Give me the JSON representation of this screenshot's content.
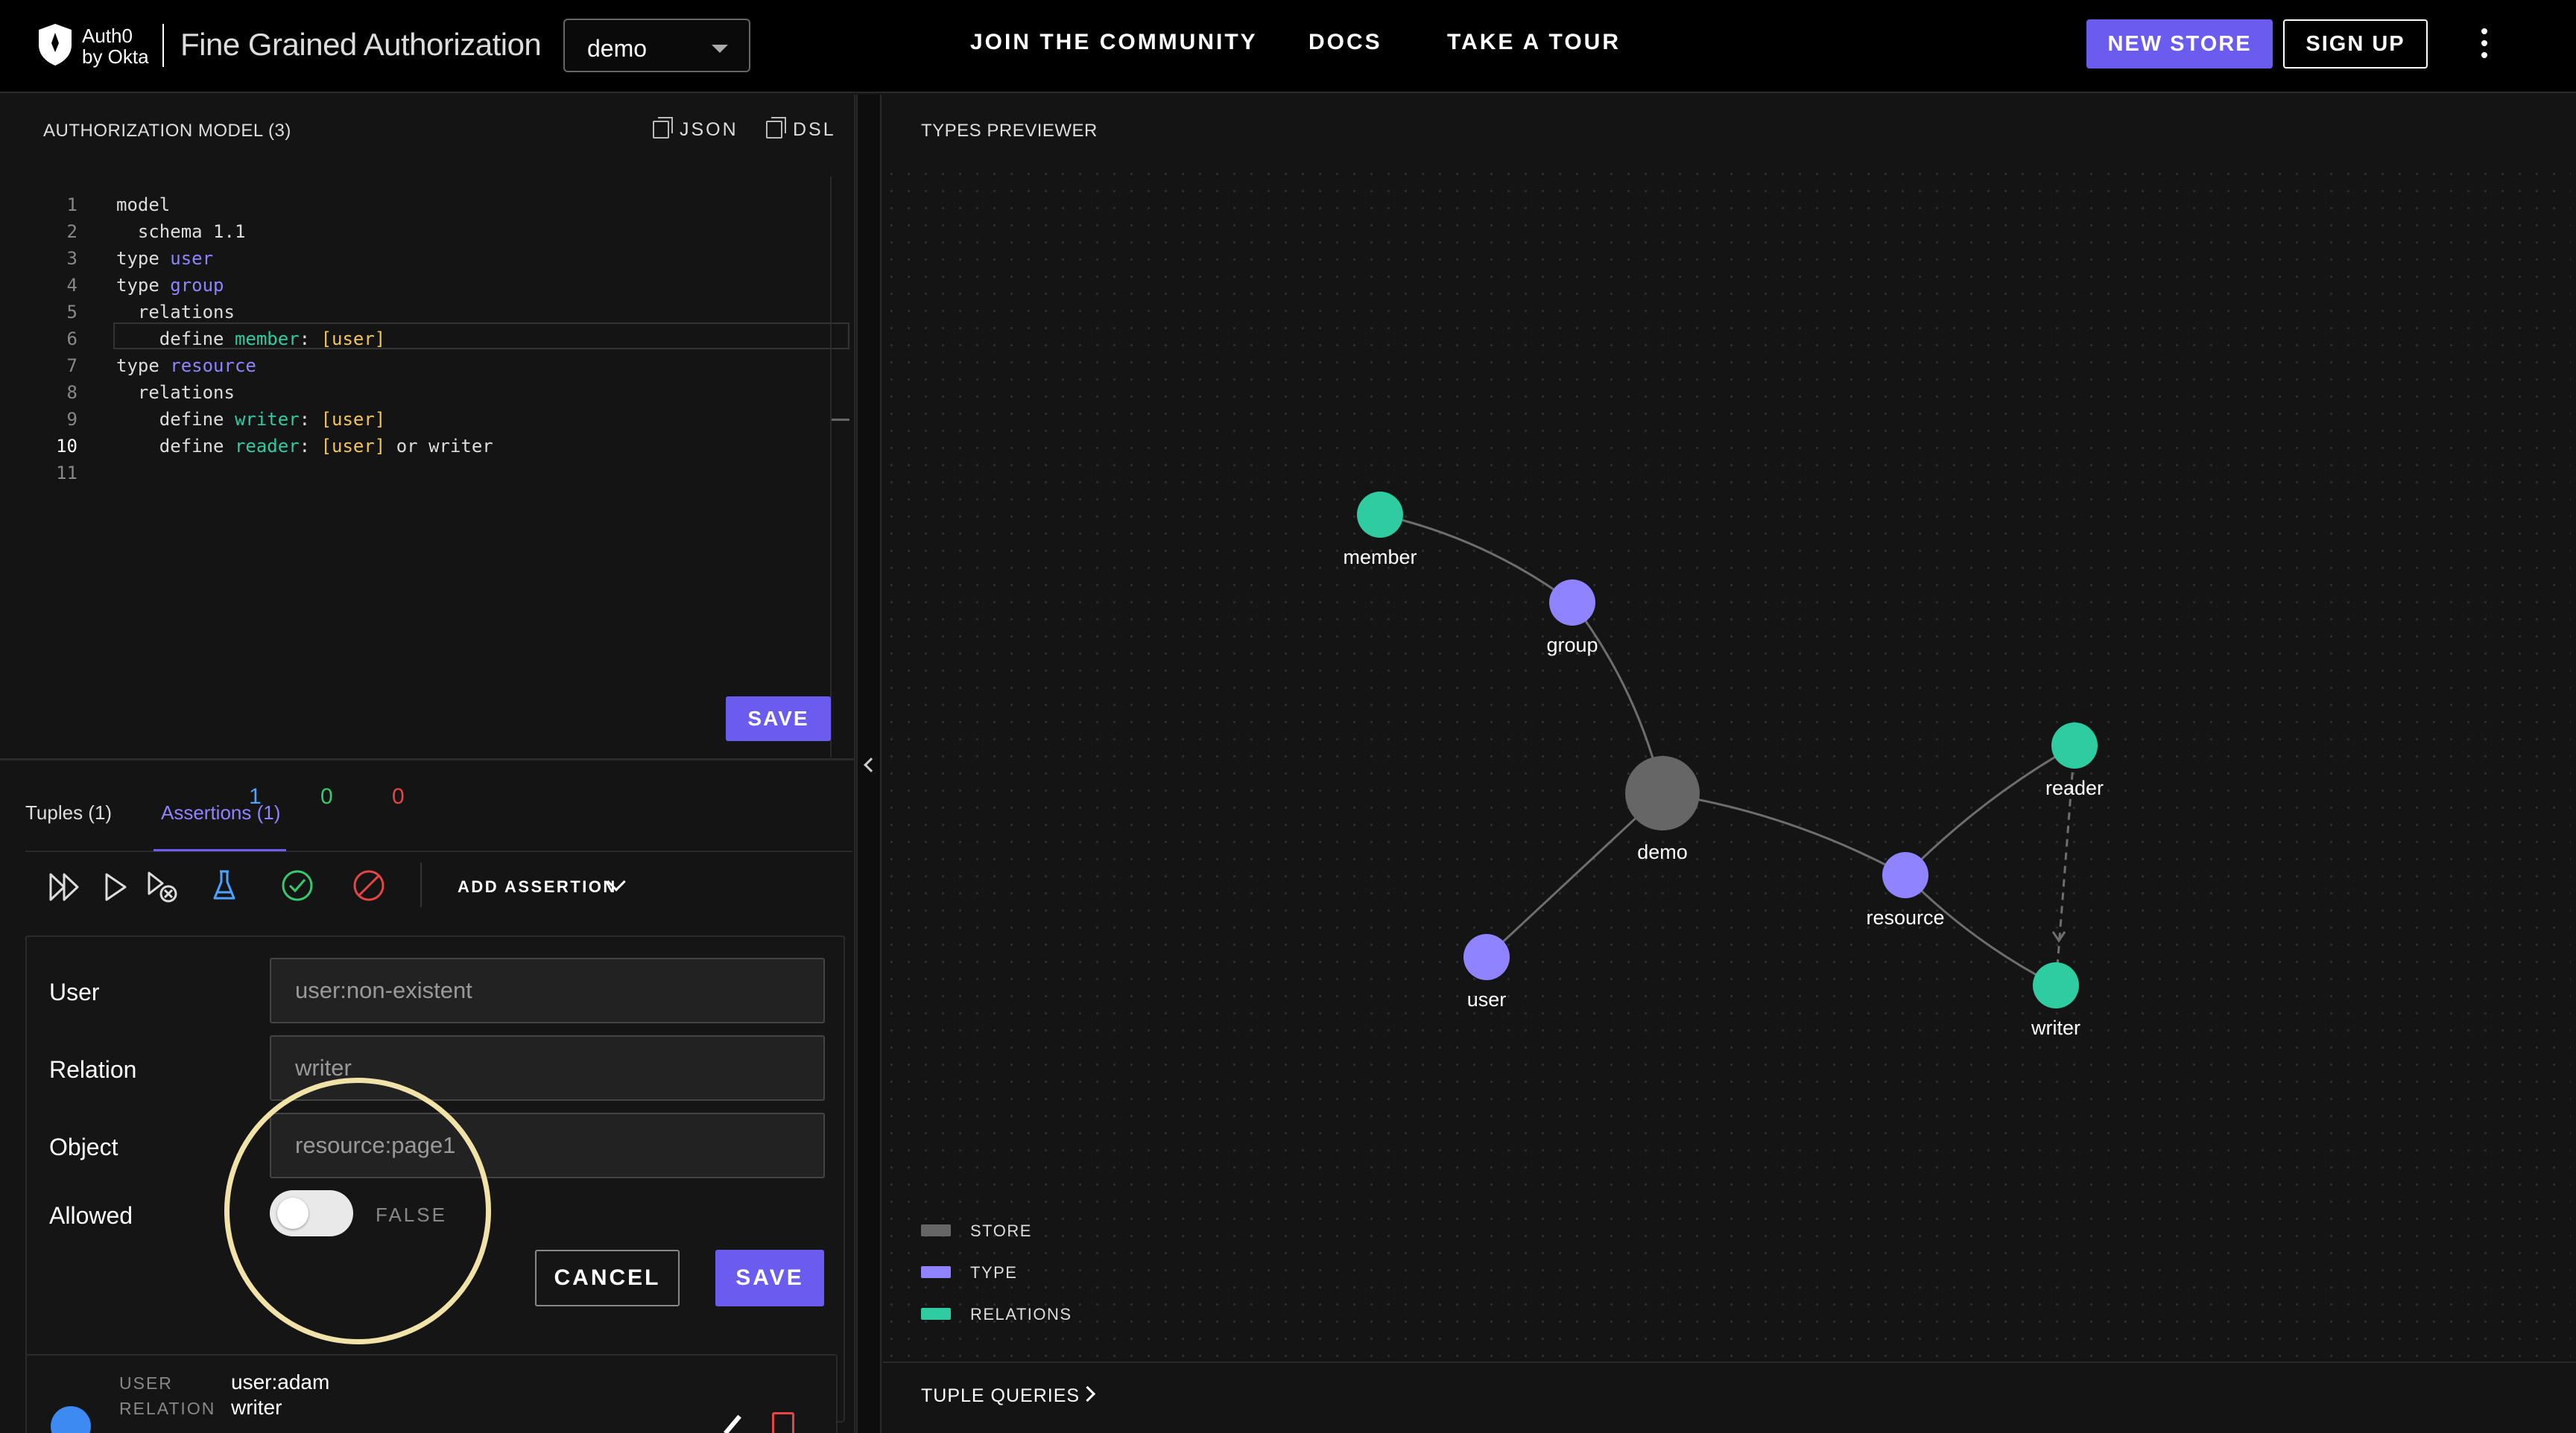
{
  "header": {
    "logo_line1": "Auth0",
    "logo_line2": "by Okta",
    "app_title": "Fine Grained Authorization",
    "store_select_value": "demo",
    "nav": [
      "JOIN  THE COMMUNITY",
      "DOCS",
      "TAKE  A  TOUR"
    ],
    "new_store_label": "NEW STORE",
    "sign_up_label": "SIGN UP"
  },
  "model_panel": {
    "title": "AUTHORIZATION MODEL (3)",
    "json_label": "JSON",
    "dsl_label": "DSL",
    "save_label": "SAVE",
    "code_lines": [
      {
        "n": "1",
        "parts": [
          [
            "model",
            "plain"
          ]
        ]
      },
      {
        "n": "2",
        "parts": [
          [
            "  schema ",
            "plain"
          ],
          [
            "1.1",
            "plain"
          ]
        ]
      },
      {
        "n": "3",
        "parts": [
          [
            "type ",
            "plain"
          ],
          [
            "user",
            "type"
          ]
        ]
      },
      {
        "n": "4",
        "parts": [
          [
            "type ",
            "plain"
          ],
          [
            "group",
            "type"
          ]
        ]
      },
      {
        "n": "5",
        "parts": [
          [
            "  relations",
            "plain"
          ]
        ]
      },
      {
        "n": "6",
        "parts": [
          [
            "    define ",
            "plain"
          ],
          [
            "member",
            "rel"
          ],
          [
            ": ",
            "plain"
          ],
          [
            "[user]",
            "bracket"
          ]
        ]
      },
      {
        "n": "7",
        "parts": [
          [
            "type ",
            "plain"
          ],
          [
            "resource",
            "type"
          ]
        ]
      },
      {
        "n": "8",
        "parts": [
          [
            "  relations",
            "plain"
          ]
        ]
      },
      {
        "n": "9",
        "parts": [
          [
            "    define ",
            "plain"
          ],
          [
            "writer",
            "rel"
          ],
          [
            ": ",
            "plain"
          ],
          [
            "[user]",
            "bracket"
          ]
        ]
      },
      {
        "n": "10",
        "parts": [
          [
            "    define ",
            "plain"
          ],
          [
            "reader",
            "rel"
          ],
          [
            ": ",
            "plain"
          ],
          [
            "[user]",
            "bracket"
          ],
          [
            " or writer",
            "plain"
          ]
        ]
      },
      {
        "n": "11",
        "parts": []
      }
    ],
    "active_line": "10"
  },
  "tabs": {
    "tuples": "Tuples (1)",
    "assertions": "Assertions (1)"
  },
  "assertion_toolbar": {
    "total_count": "1",
    "passed_count": "0",
    "failed_count": "0",
    "add_assertion_label": "ADD ASSERTION"
  },
  "assertion_form": {
    "user_label": "User",
    "user_value": "user:non-existent",
    "relation_label": "Relation",
    "relation_value": "writer",
    "object_label": "Object",
    "object_value": "resource:page1",
    "allowed_label": "Allowed",
    "allowed_state": "FALSE",
    "allowed_value": false,
    "cancel_label": "CANCEL",
    "save_label": "SAVE"
  },
  "assertion_card": {
    "user_key": "USER",
    "user_value": "user:adam",
    "relation_key": "RELATION",
    "relation_value": "writer"
  },
  "types_previewer": {
    "title": "TYPES PREVIEWER",
    "nodes": [
      {
        "id": "member",
        "label": "member",
        "kind": "relation"
      },
      {
        "id": "group",
        "label": "group",
        "kind": "type"
      },
      {
        "id": "demo",
        "label": "demo",
        "kind": "store"
      },
      {
        "id": "user",
        "label": "user",
        "kind": "type"
      },
      {
        "id": "resource",
        "label": "resource",
        "kind": "type"
      },
      {
        "id": "reader",
        "label": "reader",
        "kind": "relation"
      },
      {
        "id": "writer",
        "label": "writer",
        "kind": "relation"
      }
    ],
    "edges": [
      {
        "from": "member",
        "to": "group",
        "style": "solid"
      },
      {
        "from": "group",
        "to": "demo",
        "style": "solid"
      },
      {
        "from": "demo",
        "to": "user",
        "style": "solid"
      },
      {
        "from": "demo",
        "to": "resource",
        "style": "solid"
      },
      {
        "from": "resource",
        "to": "reader",
        "style": "solid"
      },
      {
        "from": "resource",
        "to": "writer",
        "style": "solid"
      },
      {
        "from": "reader",
        "to": "writer",
        "style": "dashed"
      }
    ],
    "legend": [
      {
        "label": "STORE",
        "color": "#666666"
      },
      {
        "label": "TYPE",
        "color": "#8f83ff"
      },
      {
        "label": "RELATIONS",
        "color": "#2ecca0"
      }
    ],
    "tuple_queries_label": "TUPLE QUERIES"
  },
  "colors": {
    "accent": "#6b5cf0",
    "type_node": "#8f83ff",
    "relation_node": "#2ecca0",
    "store_node": "#666666",
    "highlight": "#f1e3a8"
  }
}
